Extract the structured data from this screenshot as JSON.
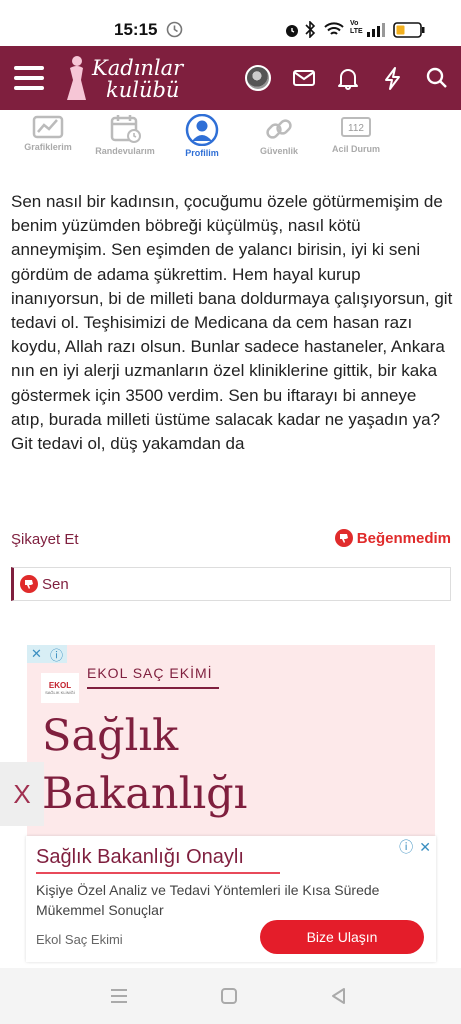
{
  "status_bar": {
    "time": "15:15",
    "icons": [
      "clock-icon",
      "alarm-icon",
      "bluetooth-icon",
      "wifi-icon",
      "volte-icon",
      "signal-icon",
      "battery-icon"
    ],
    "battery_color": "#f2b01e"
  },
  "header": {
    "logo_line1": "Kadınlar",
    "logo_line2": "kulübü",
    "bg_color": "#7f1f3e",
    "icons": [
      "menu-icon",
      "avatar",
      "mail-icon",
      "bell-icon",
      "lightning-icon",
      "search-icon"
    ]
  },
  "tabs": [
    {
      "label": "Grafiklerim",
      "icon": "chart-icon",
      "active": false
    },
    {
      "label": "Randevularım",
      "icon": "calendar-icon",
      "active": false
    },
    {
      "label": "Profilim",
      "icon": "profile-icon",
      "active": true
    },
    {
      "label": "Güvenlik",
      "icon": "link-icon",
      "active": false
    },
    {
      "label": "Acil Durum",
      "icon": "emergency-icon",
      "active": false
    }
  ],
  "tab_emergency_number": "112",
  "post": {
    "text": "Sen nasıl bir kadınsın, çocuğumu özele götürmemişim de benim yüzümden böbreği küçülmüş, nasıl kötü anneymişim. Sen eşimden de yalancı birisin, iyi ki seni gördüm de adama şükrettim. Hem hayal kurup inanıyorsun, bi de milleti bana doldurmaya çalışıyorsun, git tedavi ol. Teşhisimizi de Medicana da cem hasan razı koydu, Allah razı olsun. Bunlar sadece hastaneler, Ankara nın en iyi alerji uzmanların özel kliniklerine gittik, bir kaka göstermek için 3500 verdim. Sen bu iftarayı bi anneye atıp, burada milleti üstüme salacak kadar ne yaşadın ya? Git tedavi ol, düş yakamdan da",
    "complain_label": "Şikayet Et",
    "dislike_label": "Beğenmedim",
    "reaction_user": "Sen"
  },
  "ad": {
    "logo_text": "EKOL",
    "logo_subtext": "SAĞLIK KLİNİĞİ",
    "brand": "EKOL SAÇ EKİMİ",
    "headline_line1": "Sağlık",
    "headline_line2": "Bakanlığı",
    "close_label": "X"
  },
  "banner": {
    "title": "Sağlık Bakanlığı Onaylı",
    "description": "Kişiye Özel Analiz ve Tedavi Yöntemleri ile Kısa Sürede Mükemmel Sonuçlar",
    "source": "Ekol Saç Ekimi",
    "cta": "Bize Ulaşın"
  },
  "nav_bar": {
    "buttons": [
      "recents-icon",
      "home-icon",
      "back-icon"
    ]
  }
}
